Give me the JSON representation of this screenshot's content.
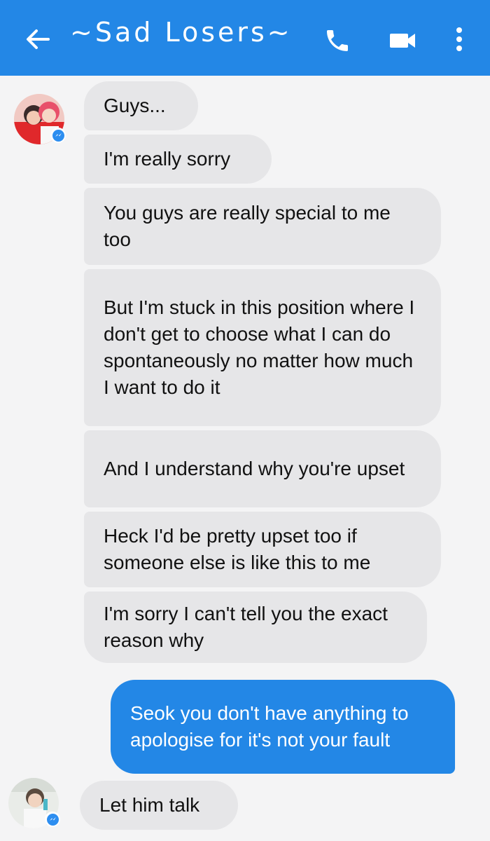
{
  "header": {
    "title": "~Sad Losers~",
    "back_icon": "arrow-left-icon",
    "call_icon": "phone-icon",
    "video_icon": "video-camera-icon",
    "more_icon": "more-vertical-icon"
  },
  "colors": {
    "accent": "#2387e6",
    "incoming_bubble": "#e6e6e8",
    "background": "#f4f4f5"
  },
  "messages": [
    {
      "direction": "incoming",
      "text": "Guys..."
    },
    {
      "direction": "incoming",
      "text": "I'm really sorry"
    },
    {
      "direction": "incoming",
      "text": "You guys are really special to me too"
    },
    {
      "direction": "incoming",
      "text": "But I'm stuck in this position where I don't get to choose what I can do spontaneously no matter how much I want to do it"
    },
    {
      "direction": "incoming",
      "text": "And I understand why you're upset"
    },
    {
      "direction": "incoming",
      "text": "Heck I'd be pretty upset too if someone else is like this to me"
    },
    {
      "direction": "incoming",
      "text": "I'm sorry I can't tell you the exact reason why"
    },
    {
      "direction": "outgoing",
      "text": "Seok you don't have anything to apologise for it's not your fault"
    },
    {
      "direction": "incoming",
      "text": "Let him talk"
    }
  ]
}
